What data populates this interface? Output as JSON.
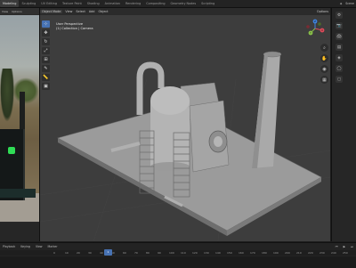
{
  "topbar": {
    "tabs": [
      "Modeling",
      "Sculpting",
      "UV Editing",
      "Texture Paint",
      "Shading",
      "Animation",
      "Rendering",
      "Compositing",
      "Geometry Nodes",
      "Scripting"
    ],
    "active_tab": 0,
    "right_label": "Scene"
  },
  "left_panel": {
    "header_items": [
      "View",
      "Options"
    ]
  },
  "viewport": {
    "header": {
      "mode": "Object Mode",
      "menus": [
        "View",
        "Select",
        "Add",
        "Object"
      ],
      "options": "Options"
    },
    "info": {
      "line1": "User Perspective",
      "line2": "(1) Collection | Camera"
    },
    "tools": [
      "cursor",
      "move",
      "rotate",
      "scale",
      "transform",
      "annotate",
      "measure",
      "add-cube"
    ],
    "active_tool": 0,
    "gizmo_axes": [
      "X",
      "Y",
      "Z"
    ]
  },
  "timeline": {
    "menus": [
      "Playback",
      "Keying",
      "View",
      "Marker"
    ],
    "ticks": [
      "0",
      "10",
      "20",
      "30",
      "40",
      "50",
      "60",
      "70",
      "80",
      "90",
      "100",
      "110",
      "120",
      "130",
      "140",
      "150",
      "160",
      "170",
      "180",
      "190",
      "200",
      "210",
      "220",
      "230",
      "240",
      "250"
    ],
    "current_frame": "1"
  },
  "colors": {
    "accent": "#4772b3",
    "viewport_bg": "#3d3d3d",
    "panel_bg": "#2a2a2a",
    "axis_x": "#e04b5a",
    "axis_y": "#8bc34a",
    "axis_z": "#3d84e0"
  }
}
